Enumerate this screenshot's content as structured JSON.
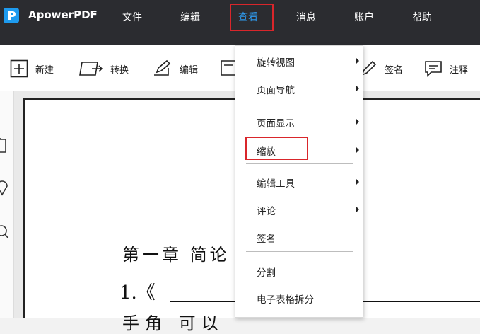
{
  "app": {
    "name": "ApowerPDF"
  },
  "menubar": {
    "items": [
      {
        "label": "文件"
      },
      {
        "label": "编辑"
      },
      {
        "label": "查看"
      },
      {
        "label": "消息"
      },
      {
        "label": "账户"
      },
      {
        "label": "帮助"
      }
    ],
    "active": "查看",
    "accent_color": "#2e9bf0",
    "highlight_color": "#d9262b"
  },
  "toolbar": {
    "new_label": "新建",
    "convert_label": "转换",
    "edit_label": "编辑",
    "sign_label": "签名",
    "comment_label": "注释"
  },
  "view_menu": {
    "items": [
      {
        "label": "旋转视图",
        "has_submenu": true
      },
      {
        "label": "页面导航",
        "has_submenu": true
      },
      {
        "label": "页面显示",
        "has_submenu": true
      },
      {
        "label": "缩放",
        "has_submenu": true,
        "highlighted": true
      },
      {
        "label": "编辑工具",
        "has_submenu": true
      },
      {
        "label": "评论",
        "has_submenu": true
      },
      {
        "label": "签名",
        "has_submenu": false
      },
      {
        "label": "分割",
        "has_submenu": false
      },
      {
        "label": "电子表格拆分",
        "has_submenu": false
      }
    ]
  },
  "document": {
    "line1": "第一章 简论",
    "line2": "1.《",
    "line3": "手角 可以"
  }
}
